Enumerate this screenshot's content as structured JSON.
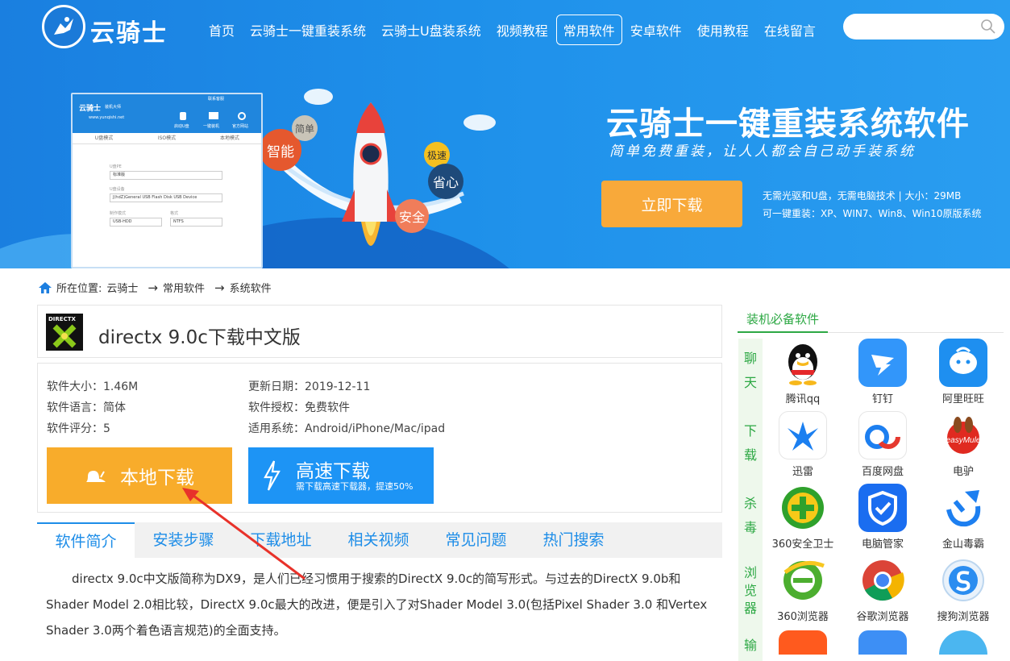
{
  "header": {
    "logo_text": "云骑士",
    "nav": [
      "首页",
      "云骑士一键重装系统",
      "云骑士U盘装系统",
      "视频教程",
      "常用软件",
      "安卓软件",
      "使用教程",
      "在线留言"
    ],
    "active_nav": "常用软件"
  },
  "hero": {
    "title": "云骑士一键重装系统软件",
    "subtitle": "简单免费重装，让人人都会自己动手装系统",
    "button": "立即下载",
    "info_line1": "无需光驱和U盘，无需电脑技术 | 大小：29MB",
    "info_line2": "可一键重装：XP、WIN7、Win8、Win10原版系统",
    "bubbles": [
      "智能",
      "简单",
      "极速",
      "省心",
      "安全"
    ],
    "mock": {
      "brand": "云骑士",
      "brand_sub": "装机大师",
      "url": "www.yunqishi.net",
      "topbar": "联系客服",
      "tools": [
        "启动U盘",
        "一键装机",
        "官方网站"
      ],
      "tabs": [
        "U盘模式",
        "ISO模式",
        "本地模式"
      ],
      "fields": [
        {
          "label": "U盘PE",
          "value": "标准版"
        },
        {
          "label": "U盘设备",
          "value": "J(hdZ)General USB Flash Disk USB Device"
        },
        {
          "label": "制作模式",
          "value": "USB-HDD"
        },
        {
          "label": "格式",
          "value": "NTFS"
        }
      ]
    }
  },
  "breadcrumb": {
    "prefix": "所在位置:",
    "items": [
      "云骑士",
      "常用软件",
      "系统软件"
    ],
    "sep": "→"
  },
  "software": {
    "icon_text": "DIRECTX",
    "title": "directx 9.0c下载中文版",
    "size": "软件大小：1.46M",
    "lang": "软件语言：简体",
    "rating": "软件评分：5",
    "date": "更新日期：2019-12-11",
    "license": "软件授权：免费软件",
    "os": "适用系统：Android/iPhone/Mac/ipad",
    "btn_local": "本地下载",
    "btn_fast": "高速下载",
    "btn_fast_sub": "需下载高速下载器，提速50%"
  },
  "tabs": [
    "软件简介",
    "安装步骤",
    "下载地址",
    "相关视频",
    "常见问题",
    "热门搜索"
  ],
  "description": "directx 9.0c中文版简称为DX9，是人们已经习惯用于搜索的DirectX 9.0c的简写形式。与过去的DirectX 9.0b和Shader Model 2.0相比较，DirectX 9.0c最大的改进，便是引入了对Shader Model 3.0(包括Pixel Shader 3.0 和Vertex Shader 3.0两个着色语言规范)的全面支持。",
  "sidebar": {
    "title": "装机必备软件",
    "categories": [
      "聊天",
      "下载",
      "杀毒",
      "浏览器",
      "输"
    ],
    "apps": [
      {
        "name": "腾讯qq",
        "icon": "qq-icon",
        "color": "#ffffff"
      },
      {
        "name": "钉钉",
        "icon": "dingtalk-icon",
        "color": "#3296fa"
      },
      {
        "name": "阿里旺旺",
        "icon": "aliwangwang-icon",
        "color": "#1e8ff0"
      },
      {
        "name": "迅雷",
        "icon": "xunlei-icon",
        "color": "#ffffff"
      },
      {
        "name": "百度网盘",
        "icon": "baidu-netdisk-icon",
        "color": "#ffffff"
      },
      {
        "name": "电驴",
        "icon": "emule-icon",
        "color": "#ffffff"
      },
      {
        "name": "360安全卫士",
        "icon": "360-safe-icon",
        "color": "#ffffff"
      },
      {
        "name": "电脑管家",
        "icon": "tencent-pc-manager-icon",
        "color": "#1a6df0"
      },
      {
        "name": "金山毒霸",
        "icon": "kingsoft-antivirus-icon",
        "color": "#ffffff"
      },
      {
        "name": "360浏览器",
        "icon": "360-browser-icon",
        "color": "#ffffff"
      },
      {
        "name": "谷歌浏览器",
        "icon": "chrome-icon",
        "color": "#ffffff"
      },
      {
        "name": "搜狗浏览器",
        "icon": "sogou-browser-icon",
        "color": "#ffffff"
      }
    ]
  },
  "colors": {
    "hero_bg": "#1e8ceb",
    "accent_orange": "#f8ac2b",
    "accent_blue": "#1d94f5",
    "sidebar_green": "#2da844",
    "annotation_red": "#e8322a"
  }
}
